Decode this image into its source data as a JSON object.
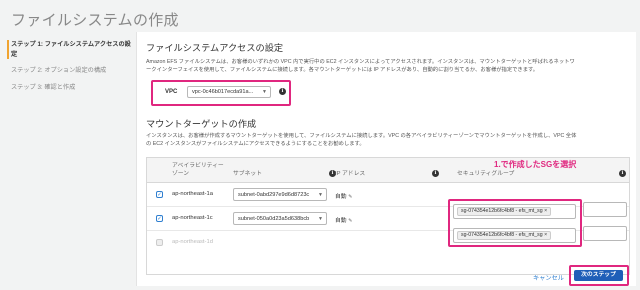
{
  "page_title": "ファイルシステムの作成",
  "steps": [
    {
      "label": "ステップ 1: ファイルシステムアクセスの設定",
      "active": true
    },
    {
      "label": "ステップ 2: オプション設定の構成",
      "active": false
    },
    {
      "label": "ステップ 3: 確認と作成",
      "active": false
    }
  ],
  "access": {
    "heading": "ファイルシステムアクセスの設定",
    "desc1": "Amazon EFS ファイルシステムは、お客様のいずれかの VPC 内で実行中の EC2 インスタンスによってアクセスされます。インスタンスは、マウントターゲットと呼ばれるネットワ",
    "desc2": "ークインターフェイスを使用して、ファイルシステムに接続します。各マウントターゲットには IP アドレスがあり、自動的に割り当てるか、お客様が指定できます。",
    "vpc_label": "VPC",
    "vpc_value": "vpc-0c46b017ecda91a..."
  },
  "mount": {
    "heading": "マウントターゲットの作成",
    "desc1": "インスタンスは、お客様が作成するマウントターゲットを使用して、ファイルシステムに接続します。VPC の各アベイラビリティーゾーンでマウントターゲットを作成し、VPC 全体",
    "desc2": "の EC2 インスタンスがファイルシステムにアクセスできるようにすることをお勧めします。",
    "columns": {
      "az_line1": "アベイラビリティー",
      "az_line2": "ゾーン",
      "subnet": "サブネット",
      "ip": "IP アドレス",
      "sg": "セキュリティグループ"
    },
    "rows": [
      {
        "checked": true,
        "az": "ap-northeast-1a",
        "subnet": "subnet-0abd297e9d6d8723c",
        "ip": "自動",
        "sg": "sg-074354e12b6fc4bf8 - efs_mt_sg"
      },
      {
        "checked": true,
        "az": "ap-northeast-1c",
        "subnet": "subnet-050a0d23a5d638bcb",
        "ip": "自動",
        "sg": "sg-074354e12b6fc4bf8 - efs_mt_sg"
      },
      {
        "checked": false,
        "az": "ap-northeast-1d",
        "subnet": "",
        "ip": "",
        "sg": ""
      }
    ]
  },
  "annotation": "1.で作成したSGを選択",
  "footer": {
    "cancel": "キャンセル",
    "next": "次のステップ"
  },
  "icons": {
    "info": "info-icon",
    "pencil": "pencil-icon",
    "caret": "caret-down-icon",
    "check": "checkmark-icon",
    "tag_remove": "close-icon"
  },
  "colors": {
    "highlight": "#e0277f",
    "primary_button": "#1f5fb8",
    "link": "#2f7fd0",
    "active_step_marker": "#f0a330"
  }
}
